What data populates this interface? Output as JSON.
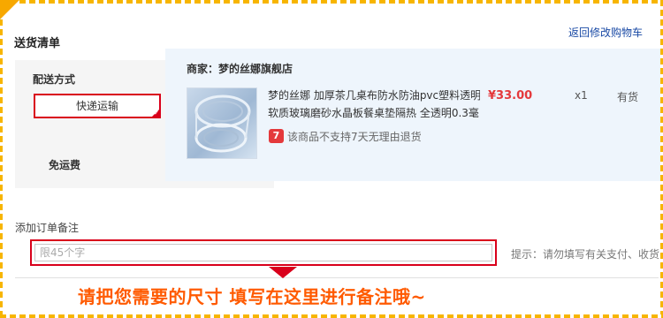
{
  "header": {
    "title": "送货清单",
    "back_link": "返回修改购物车"
  },
  "delivery": {
    "method_label": "配送方式",
    "selected_option": "快递运输",
    "shipping_fee": "免运费"
  },
  "order": {
    "shop_line": "商家：梦的丝娜旗舰店",
    "item": {
      "title_line1": "梦的丝娜 加厚茶几桌布防水防油pvc塑料透明",
      "title_line2": "软质玻璃磨砂水晶板餐桌垫隔热 全透明0.3毫",
      "price": "¥33.00",
      "quantity": "x1",
      "stock_status": "有货",
      "return_badge": "7",
      "return_policy": "该商品不支持7天无理由退货"
    }
  },
  "remark": {
    "label": "添加订单备注",
    "placeholder": "限45个字",
    "hint": "提示：请勿填写有关支付、收货"
  },
  "callout": {
    "text": "请把您需要的尺寸 填写在这里进行备注哦~"
  },
  "colors": {
    "accent_red": "#d9001b",
    "price_red": "#e4393c",
    "callout_orange": "#ff5a00",
    "frame_orange": "#f7b500",
    "link_blue": "#1a4aa5"
  }
}
